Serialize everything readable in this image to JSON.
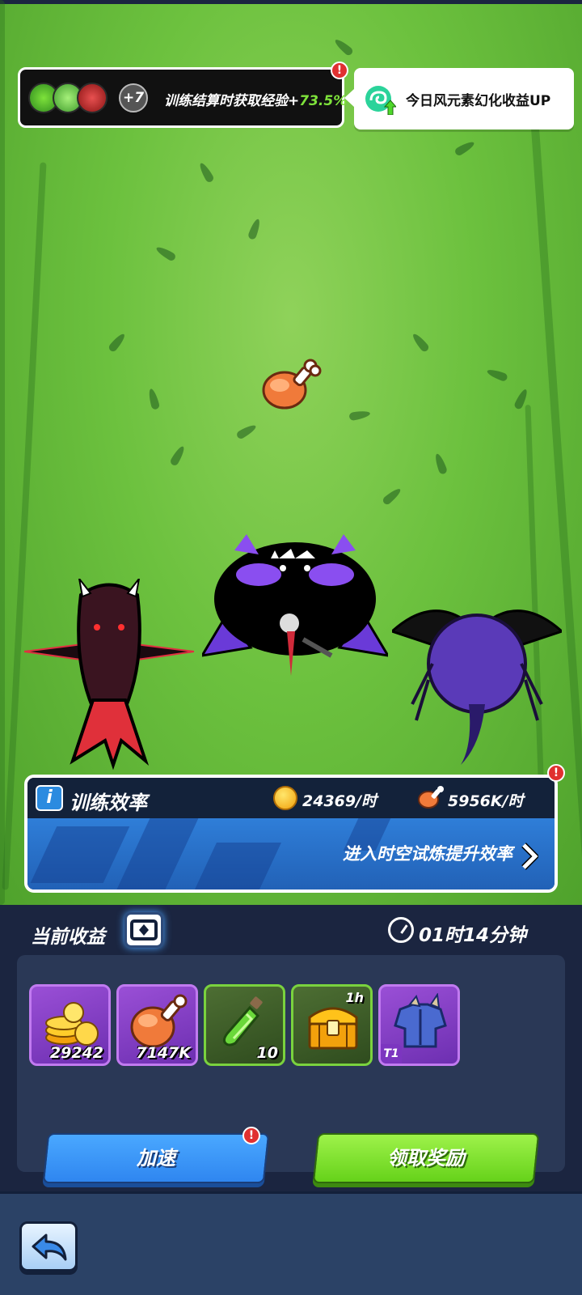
{
  "buff": {
    "extra_count": "+7",
    "text": "训练结算时获取经验+",
    "value": "73.5%",
    "alert": "!"
  },
  "daily_tip": {
    "text": "今日风元素幻化收益UP"
  },
  "efficiency": {
    "title": "训练效率",
    "coin_rate": "24369/时",
    "meat_rate": "5956K/时",
    "trial_link": "进入时空试炼提升效率",
    "alert": "!"
  },
  "rewards": {
    "title": "当前收益",
    "timer": "01时14分钟",
    "items": [
      {
        "icon": "gold-coins-icon",
        "quantity": "29242",
        "rarity": "purple"
      },
      {
        "icon": "meat-icon",
        "quantity": "7147K",
        "rarity": "purple"
      },
      {
        "icon": "green-potion-icon",
        "quantity": "10",
        "rarity": "green"
      },
      {
        "icon": "treasure-chest-icon",
        "tag": "1h",
        "rarity": "green"
      },
      {
        "icon": "armor-icon",
        "tier": "T1",
        "rarity": "purple"
      }
    ]
  },
  "buttons": {
    "speed_up": "加速",
    "speed_alert": "!",
    "claim": "领取奖励"
  },
  "colors": {
    "accent_green": "#7ee23b",
    "button_blue": "#2f86f0",
    "button_green": "#66d21a",
    "panel_dark": "#1b2540"
  }
}
